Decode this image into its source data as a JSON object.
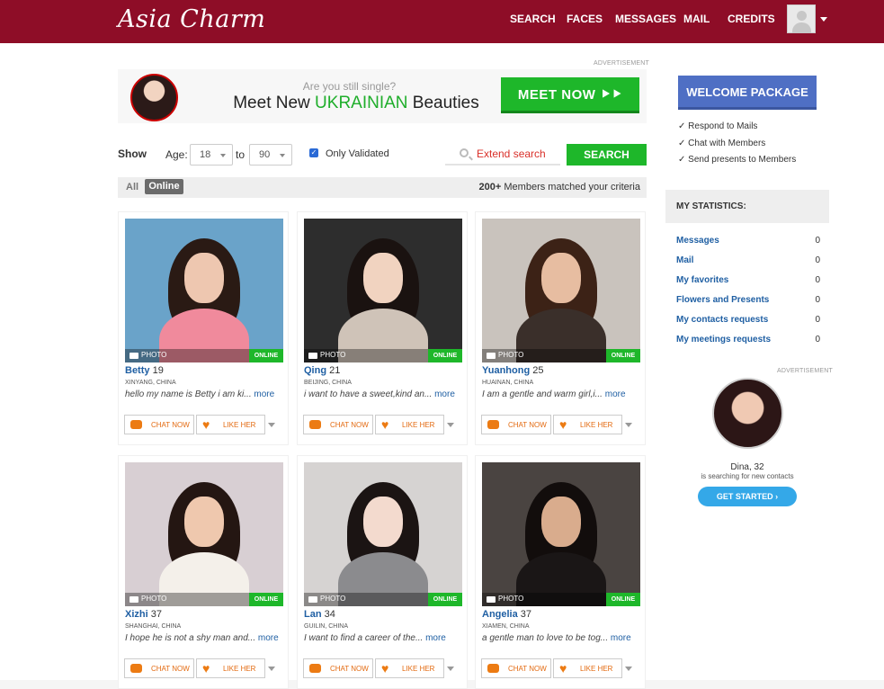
{
  "header": {
    "logo": "Asia Charm",
    "nav": [
      "SEARCH",
      "FACES",
      "MESSAGES",
      "MAIL",
      "CREDITS"
    ]
  },
  "ad_banner": {
    "label": "ADVERTISEMENT",
    "question": "Are you still single?",
    "headline_pre": "Meet New ",
    "headline_highlight": "UKRAINIAN",
    "headline_post": " Beauties",
    "cta": "MEET NOW ⯈⯈"
  },
  "filters": {
    "show_label": "Show",
    "age_label": "Age:",
    "age_from": "18",
    "to_label": "to",
    "age_to": "90",
    "only_validated": "Only Validated",
    "extend_search": "Extend search",
    "search_button": "SEARCH",
    "tab_all": "All",
    "tab_online": "Online",
    "matched_count": "200+",
    "matched_text": " Members matched your criteria"
  },
  "card_labels": {
    "photo": "PHOTO",
    "online": "ONLINE",
    "chat": "CHAT NOW",
    "like": "LIKE HER",
    "more": "more"
  },
  "profiles": [
    {
      "name": "Betty",
      "age": "19",
      "location": "XINYANG, CHINA",
      "bio": "hello my name is Betty i am ki...",
      "bg": "#6aa3c9",
      "hair": "#2a1a14",
      "skin": "#eec7b0",
      "cloth": "#f08a9c"
    },
    {
      "name": "Qing",
      "age": "21",
      "location": "BEIJING, CHINA",
      "bio": "i want to have a sweet,kind an...",
      "bg": "#2d2d2d",
      "hair": "#1a1210",
      "skin": "#f1d3c0",
      "cloth": "#cfc3b8"
    },
    {
      "name": "Yuanhong",
      "age": "25",
      "location": "HUAINAN, CHINA",
      "bio": "I am a gentle and warm girl,i...",
      "bg": "#c9c3bd",
      "hair": "#3c2216",
      "skin": "#e7bda1",
      "cloth": "#3a2f2a"
    },
    {
      "name": "Xizhi",
      "age": "37",
      "location": "SHANGHAI, CHINA",
      "bio": "I hope he is not a shy man and...",
      "bg": "#d8cfd3",
      "hair": "#241612",
      "skin": "#efc8ae",
      "cloth": "#f4f0ea"
    },
    {
      "name": "Lan",
      "age": "34",
      "location": "GUILIN, CHINA",
      "bio": "I want to find a career of the...",
      "bg": "#d6d3d2",
      "hair": "#1b1413",
      "skin": "#f3dace",
      "cloth": "#8b8b8e"
    },
    {
      "name": "Angelia",
      "age": "37",
      "location": "XIAMEN, CHINA",
      "bio": "a gentle man to love to be tog...",
      "bg": "#4a4441",
      "hair": "#120d0c",
      "skin": "#d9ac8d",
      "cloth": "#1a1616"
    }
  ],
  "sidebar": {
    "welcome": "WELCOME PACKAGE",
    "benefits": [
      "✓ Respond to Mails",
      "✓ Chat with Members",
      "✓ Send presents to Members"
    ],
    "stats_title": "MY STATISTICS:",
    "stats": [
      {
        "label": "Messages",
        "value": "0"
      },
      {
        "label": "Mail",
        "value": "0"
      },
      {
        "label": "My favorites",
        "value": "0"
      },
      {
        "label": "Flowers and Presents",
        "value": "0"
      },
      {
        "label": "My contacts requests",
        "value": "0"
      },
      {
        "label": "My meetings requests",
        "value": "0"
      }
    ],
    "ad_label": "ADVERTISEMENT",
    "promo_name": "Dina, 32",
    "promo_text": "is searching for new contacts",
    "promo_cta": "GET STARTED ›"
  },
  "colors": {
    "brand": "#8e0d27",
    "cta_green": "#1eb72a",
    "link_blue": "#1f5fa3",
    "accent_orange": "#ec7b13"
  }
}
